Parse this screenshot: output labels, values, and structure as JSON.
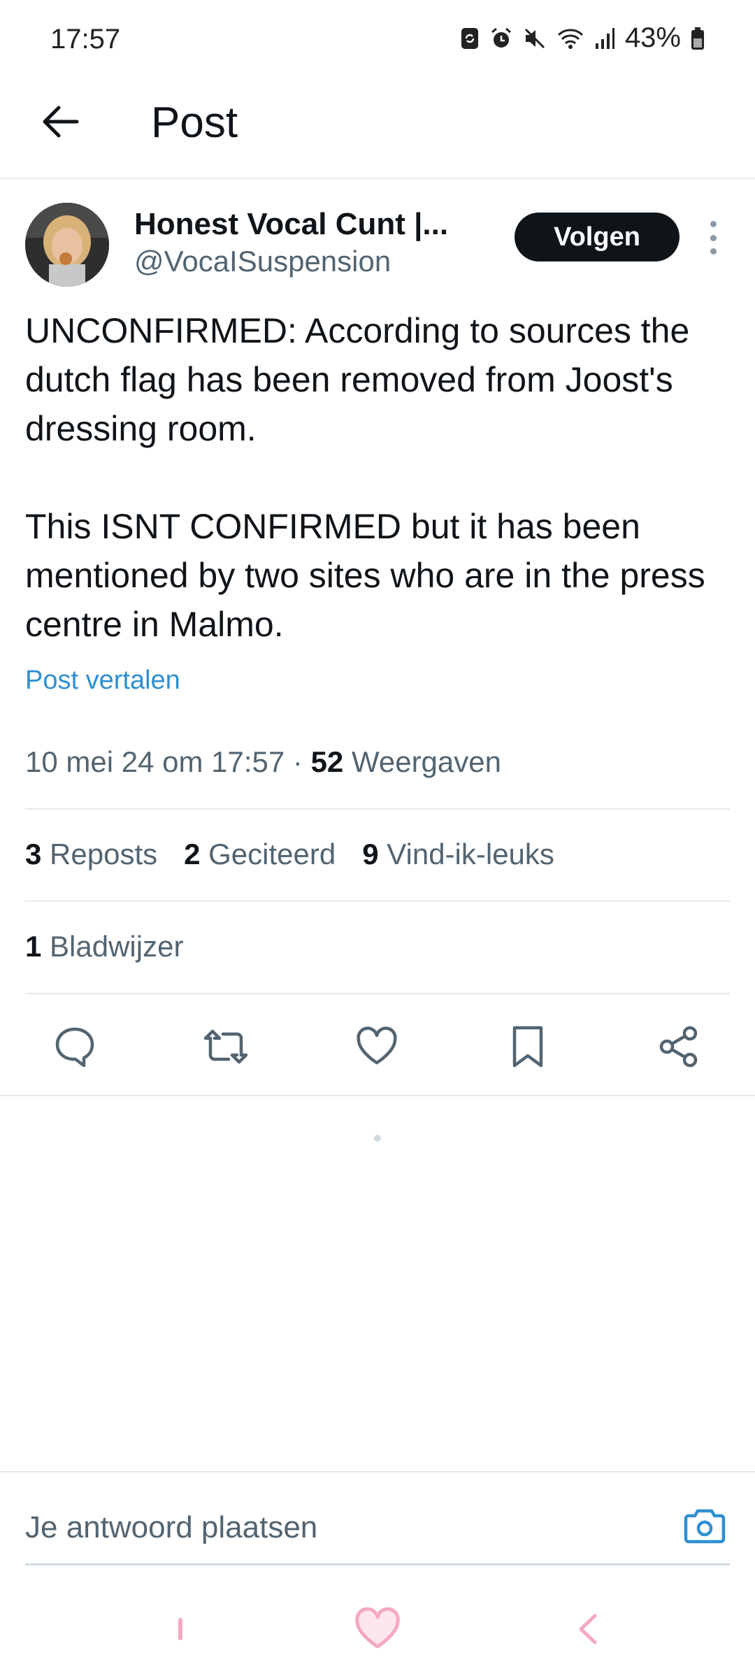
{
  "status_bar": {
    "time": "17:57",
    "battery": "43%",
    "icons": [
      "sync-icon",
      "alarm-icon",
      "mute-icon",
      "wifi-icon",
      "signal-icon",
      "battery-icon"
    ]
  },
  "header": {
    "title": "Post",
    "back_icon": "arrow-left-icon"
  },
  "post": {
    "author": {
      "name": "Honest Vocal Cunt |...",
      "handle": "@VocaISuspension"
    },
    "follow_label": "Volgen",
    "text": "UNCONFIRMED: According to sources the dutch flag has been removed from Joost's dressing room.\n\nThis ISNT CONFIRMED but it has been mentioned by two sites who are in the press centre in Malmo.",
    "translate_label": "Post vertalen",
    "timestamp": "10 mei 24 om 17:57",
    "separator": "·",
    "views_count": "52",
    "views_label": "Weergaven",
    "stats": {
      "reposts_count": "3",
      "reposts_label": "Reposts",
      "quotes_count": "2",
      "quotes_label": "Geciteerd",
      "likes_count": "9",
      "likes_label": "Vind-ik-leuks",
      "bookmarks_count": "1",
      "bookmarks_label": "Bladwijzer"
    },
    "actions": [
      "reply-icon",
      "repost-icon",
      "like-icon",
      "bookmark-icon",
      "share-icon"
    ]
  },
  "reply": {
    "placeholder": "Je antwoord plaatsen",
    "camera_icon": "camera-icon"
  },
  "colors": {
    "text_primary": "#0f1419",
    "text_secondary": "#536471",
    "link": "#2f8fd0",
    "divider": "#e7e9ea",
    "nav_pink": "#f4a8c4"
  }
}
